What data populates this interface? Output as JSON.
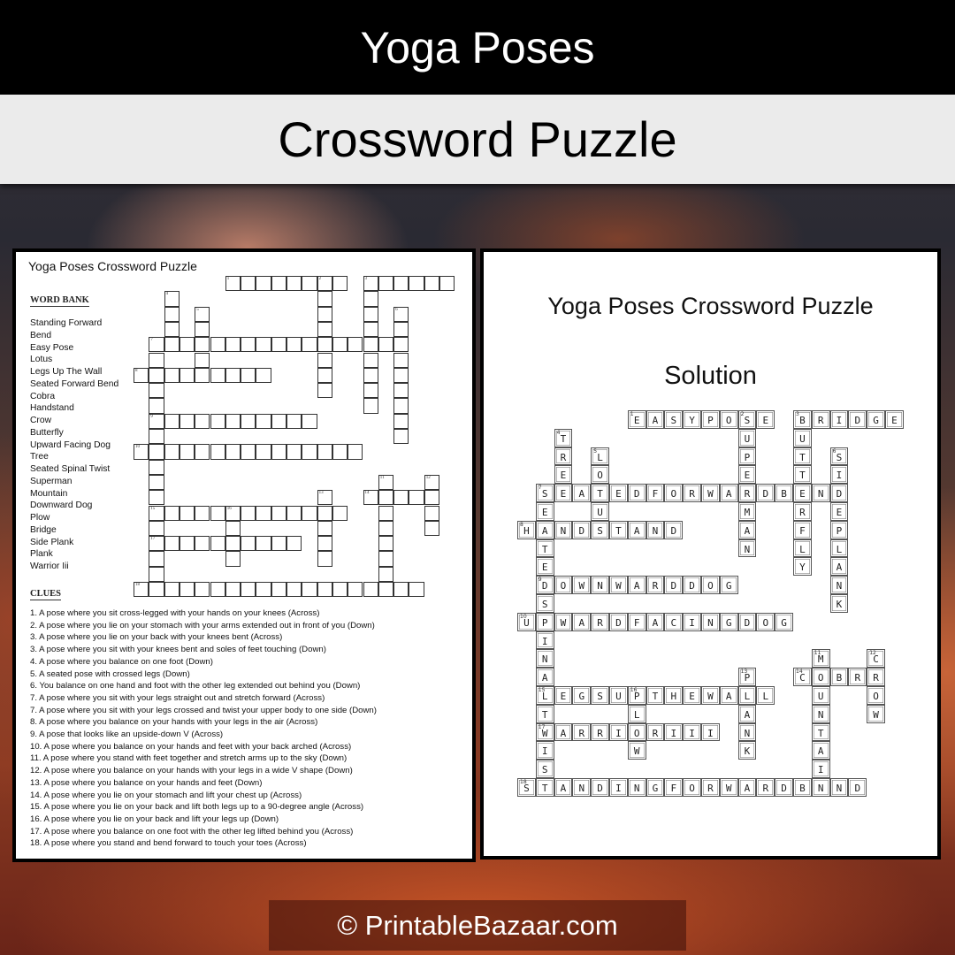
{
  "header": {
    "title": "Yoga Poses",
    "subtitle": "Crossword Puzzle"
  },
  "puzzle_sheet": {
    "title": "Yoga Poses Crossword Puzzle",
    "word_bank_heading": "WORD BANK",
    "word_bank": [
      "Standing Forward",
      "Bend",
      "Easy Pose",
      "Lotus",
      "Legs Up The Wall",
      "Seated Forward Bend",
      "Cobra",
      "Handstand",
      "Crow",
      "Butterfly",
      "Upward Facing Dog",
      "Tree",
      "Seated Spinal Twist",
      "Superman",
      "Mountain",
      "Downward Dog",
      "Plow",
      "Bridge",
      "Side Plank",
      "Plank",
      "Warrior Iii"
    ],
    "clues_heading": "CLUES",
    "clues": [
      "1. A pose where you sit cross-legged with your hands on your knees (Across)",
      "2. A pose where you lie on your stomach with your arms extended out in front of you (Down)",
      "3. A pose where you lie on your back with your knees bent (Across)",
      "3. A pose where you sit with your knees bent and soles of feet touching (Down)",
      "4. A pose where you balance on one foot (Down)",
      "5. A seated pose with crossed legs (Down)",
      "6. You balance on one hand and foot with the other leg extended out behind you (Down)",
      "7. A pose where you sit with your legs straight out and stretch forward (Across)",
      "7. A pose where you sit with your legs crossed and twist your upper body to one side (Down)",
      "8. A pose where you balance on your hands with your legs in the air (Across)",
      "9. A pose that looks like an upside-down V (Across)",
      "10. A pose where you balance on your hands and feet with your back arched (Across)",
      "11. A pose where you stand with feet together and stretch arms up to the sky (Down)",
      "12. A pose where you balance on your hands with your legs in a wide V shape (Down)",
      "13. A pose where you balance on your hands and feet (Down)",
      "14. A pose where you lie on your stomach and lift your chest up (Across)",
      "15. A pose where you lie on your back and lift both legs up to a 90-degree angle (Across)",
      "16. A pose where you lie on your back and lift your legs up (Down)",
      "17. A pose where you balance on one foot with the other leg lifted behind you (Across)",
      "18. A pose where you stand and bend forward to touch your toes (Across)"
    ]
  },
  "solution_sheet": {
    "title": "Yoga Poses Crossword Puzzle",
    "subtitle": "Solution"
  },
  "crossword": {
    "entries": [
      {
        "number": 1,
        "direction": "across",
        "row": 0,
        "col": 6,
        "answer": "EASYPOSE"
      },
      {
        "number": 2,
        "direction": "down",
        "row": 0,
        "col": 12,
        "answer": "SUPERMAN"
      },
      {
        "number": 3,
        "direction": "across",
        "row": 0,
        "col": 15,
        "answer": "BRIDGE"
      },
      {
        "number": 3,
        "direction": "down",
        "row": 0,
        "col": 15,
        "answer": "BUTTERFLY"
      },
      {
        "number": 4,
        "direction": "down",
        "row": 1,
        "col": 2,
        "answer": "TREE"
      },
      {
        "number": 5,
        "direction": "down",
        "row": 2,
        "col": 4,
        "answer": "LOTUS"
      },
      {
        "number": 6,
        "direction": "down",
        "row": 2,
        "col": 17,
        "answer": "SIDEPLANK"
      },
      {
        "number": 7,
        "direction": "across",
        "row": 4,
        "col": 1,
        "answer": "SEATEDFORWARDBEND"
      },
      {
        "number": 7,
        "direction": "down",
        "row": 4,
        "col": 1,
        "answer": "SEATEDSPINALTWIST"
      },
      {
        "number": 8,
        "direction": "across",
        "row": 6,
        "col": 0,
        "answer": "HANDSTAND"
      },
      {
        "number": 9,
        "direction": "across",
        "row": 9,
        "col": 1,
        "answer": "DOWNWARDDOG"
      },
      {
        "number": 10,
        "direction": "across",
        "row": 11,
        "col": 0,
        "answer": "UPWARDFACINGDOG"
      },
      {
        "number": 11,
        "direction": "down",
        "row": 13,
        "col": 16,
        "answer": "MOUNTAIN"
      },
      {
        "number": 12,
        "direction": "down",
        "row": 13,
        "col": 19,
        "answer": "CROW"
      },
      {
        "number": 13,
        "direction": "down",
        "row": 14,
        "col": 12,
        "answer": "PLANK"
      },
      {
        "number": 14,
        "direction": "across",
        "row": 14,
        "col": 15,
        "answer": "COBRA"
      },
      {
        "number": 15,
        "direction": "across",
        "row": 15,
        "col": 1,
        "answer": "LEGSUPTHEWALL"
      },
      {
        "number": 16,
        "direction": "down",
        "row": 15,
        "col": 6,
        "answer": "PLOW"
      },
      {
        "number": 17,
        "direction": "across",
        "row": 17,
        "col": 1,
        "answer": "WARRIORIII"
      },
      {
        "number": 18,
        "direction": "across",
        "row": 20,
        "col": 0,
        "answer": "STANDINGFORWARDBEND"
      }
    ]
  },
  "footer": {
    "copyright": "© PrintableBazaar.com"
  }
}
